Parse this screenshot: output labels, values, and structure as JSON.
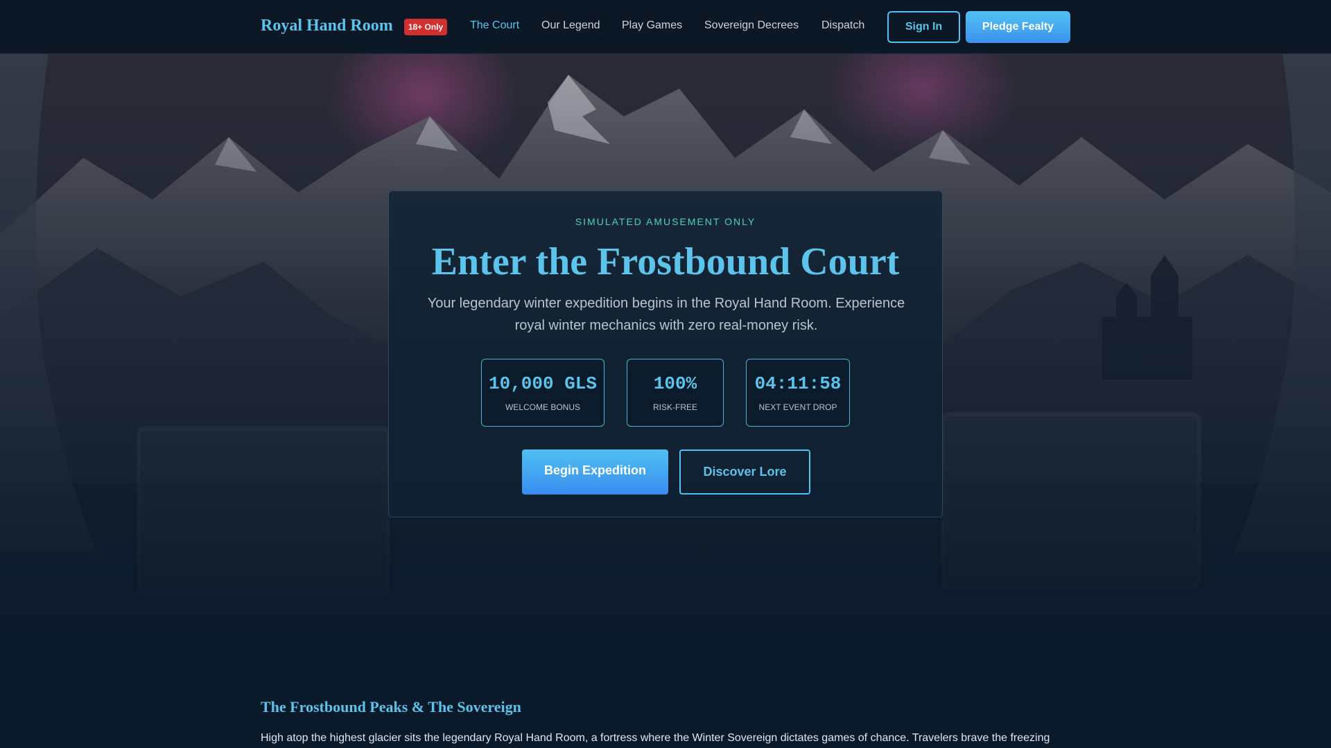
{
  "nav": {
    "brand": "Royal Hand Room",
    "age_badge": "18+ Only",
    "links": [
      {
        "label": "The Court",
        "active": true
      },
      {
        "label": "Our Legend",
        "active": false
      },
      {
        "label": "Play Games",
        "active": false
      },
      {
        "label": "Sovereign Decrees",
        "active": false
      },
      {
        "label": "Dispatch",
        "active": false
      }
    ],
    "sign_in": "Sign In",
    "pledge": "Pledge Fealty"
  },
  "hero": {
    "eyebrow": "SIMULATED AMUSEMENT ONLY",
    "title": "Enter the Frostbound Court",
    "subtitle": "Your legendary winter expedition begins in the Royal Hand Room. Experience royal winter mechanics with zero real-money risk.",
    "stats": [
      {
        "value": "10,000 GLS",
        "label": "Welcome Bonus"
      },
      {
        "value": "100%",
        "label": "Risk-Free"
      },
      {
        "value": "04:11:58",
        "label": "Next Event Drop"
      }
    ],
    "primary_cta": "Begin Expedition",
    "secondary_cta": "Discover Lore"
  },
  "lore": {
    "heading": "The Frostbound Peaks & The Sovereign",
    "text": "High atop the highest glacier sits the legendary Royal Hand Room, a fortress where the Winter Sovereign dictates games of chance. Travelers brave the freezing"
  },
  "colors": {
    "accent": "#5cc3eb",
    "teal": "#4fd1c5",
    "badge_red": "#d32f2f",
    "nav_bg": "#0c1826",
    "page_bg": "#0b1a2b"
  }
}
